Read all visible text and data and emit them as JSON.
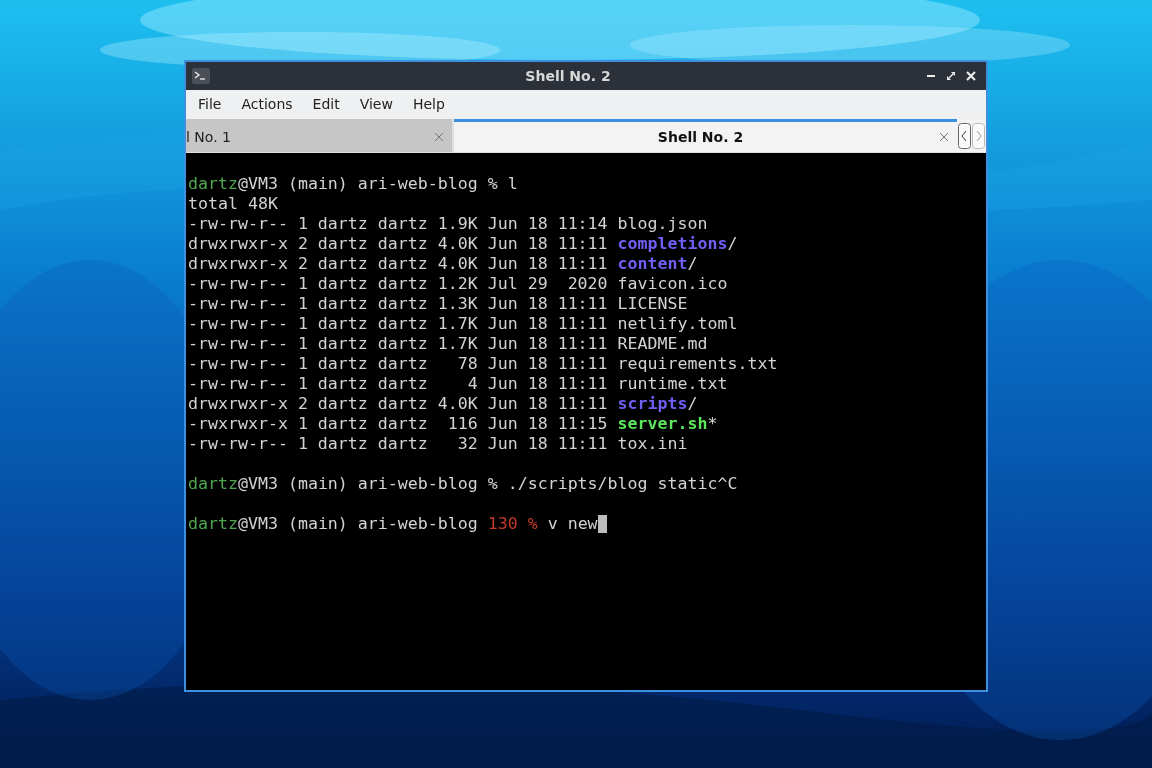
{
  "window": {
    "title": "Shell No. 2"
  },
  "menu": [
    "File",
    "Actions",
    "Edit",
    "View",
    "Help"
  ],
  "tabs": [
    {
      "label": "l No. 1",
      "selected": false
    },
    {
      "label": "Shell No. 2",
      "selected": true
    }
  ],
  "terminal": {
    "lines": [
      {
        "segments": [
          {
            "text": "dartz",
            "kind": "user"
          },
          {
            "text": "@VM3 (main) ari-web-blog % l",
            "kind": "plain"
          }
        ]
      },
      {
        "segments": [
          {
            "text": "total 48K",
            "kind": "plain"
          }
        ]
      },
      {
        "segments": [
          {
            "text": "-rw-rw-r-- 1 dartz dartz 1.9K Jun 18 11:14 blog.json",
            "kind": "plain"
          }
        ]
      },
      {
        "segments": [
          {
            "text": "drwxrwxr-x 2 dartz dartz 4.0K Jun 18 11:11 ",
            "kind": "plain"
          },
          {
            "text": "completions",
            "kind": "dir"
          },
          {
            "text": "/",
            "kind": "plain"
          }
        ]
      },
      {
        "segments": [
          {
            "text": "drwxrwxr-x 2 dartz dartz 4.0K Jun 18 11:11 ",
            "kind": "plain"
          },
          {
            "text": "content",
            "kind": "dir"
          },
          {
            "text": "/",
            "kind": "plain"
          }
        ]
      },
      {
        "segments": [
          {
            "text": "-rw-rw-r-- 1 dartz dartz 1.2K Jul 29  2020 favicon.ico",
            "kind": "plain"
          }
        ]
      },
      {
        "segments": [
          {
            "text": "-rw-rw-r-- 1 dartz dartz 1.3K Jun 18 11:11 LICENSE",
            "kind": "plain"
          }
        ]
      },
      {
        "segments": [
          {
            "text": "-rw-rw-r-- 1 dartz dartz 1.7K Jun 18 11:11 netlify.toml",
            "kind": "plain"
          }
        ]
      },
      {
        "segments": [
          {
            "text": "-rw-rw-r-- 1 dartz dartz 1.7K Jun 18 11:11 README.md",
            "kind": "plain"
          }
        ]
      },
      {
        "segments": [
          {
            "text": "-rw-rw-r-- 1 dartz dartz   78 Jun 18 11:11 requirements.txt",
            "kind": "plain"
          }
        ]
      },
      {
        "segments": [
          {
            "text": "-rw-rw-r-- 1 dartz dartz    4 Jun 18 11:11 runtime.txt",
            "kind": "plain"
          }
        ]
      },
      {
        "segments": [
          {
            "text": "drwxrwxr-x 2 dartz dartz 4.0K Jun 18 11:11 ",
            "kind": "plain"
          },
          {
            "text": "scripts",
            "kind": "dir"
          },
          {
            "text": "/",
            "kind": "plain"
          }
        ]
      },
      {
        "segments": [
          {
            "text": "-rwxrwxr-x 1 dartz dartz  116 Jun 18 11:15 ",
            "kind": "plain"
          },
          {
            "text": "server.sh",
            "kind": "exec"
          },
          {
            "text": "*",
            "kind": "plain"
          }
        ]
      },
      {
        "segments": [
          {
            "text": "-rw-rw-r-- 1 dartz dartz   32 Jun 18 11:11 tox.ini",
            "kind": "plain"
          }
        ]
      },
      {
        "kind": "blank"
      },
      {
        "segments": [
          {
            "text": "dartz",
            "kind": "user"
          },
          {
            "text": "@VM3 (main) ari-web-blog % ./scripts/blog static^C",
            "kind": "plain"
          }
        ]
      },
      {
        "kind": "blank"
      },
      {
        "segments": [
          {
            "text": "dartz",
            "kind": "user"
          },
          {
            "text": "@VM3 (main) ari-web-blog ",
            "kind": "plain"
          },
          {
            "text": "130 %",
            "kind": "error"
          },
          {
            "text": " v new",
            "kind": "plain"
          }
        ],
        "cursor": true
      }
    ]
  }
}
